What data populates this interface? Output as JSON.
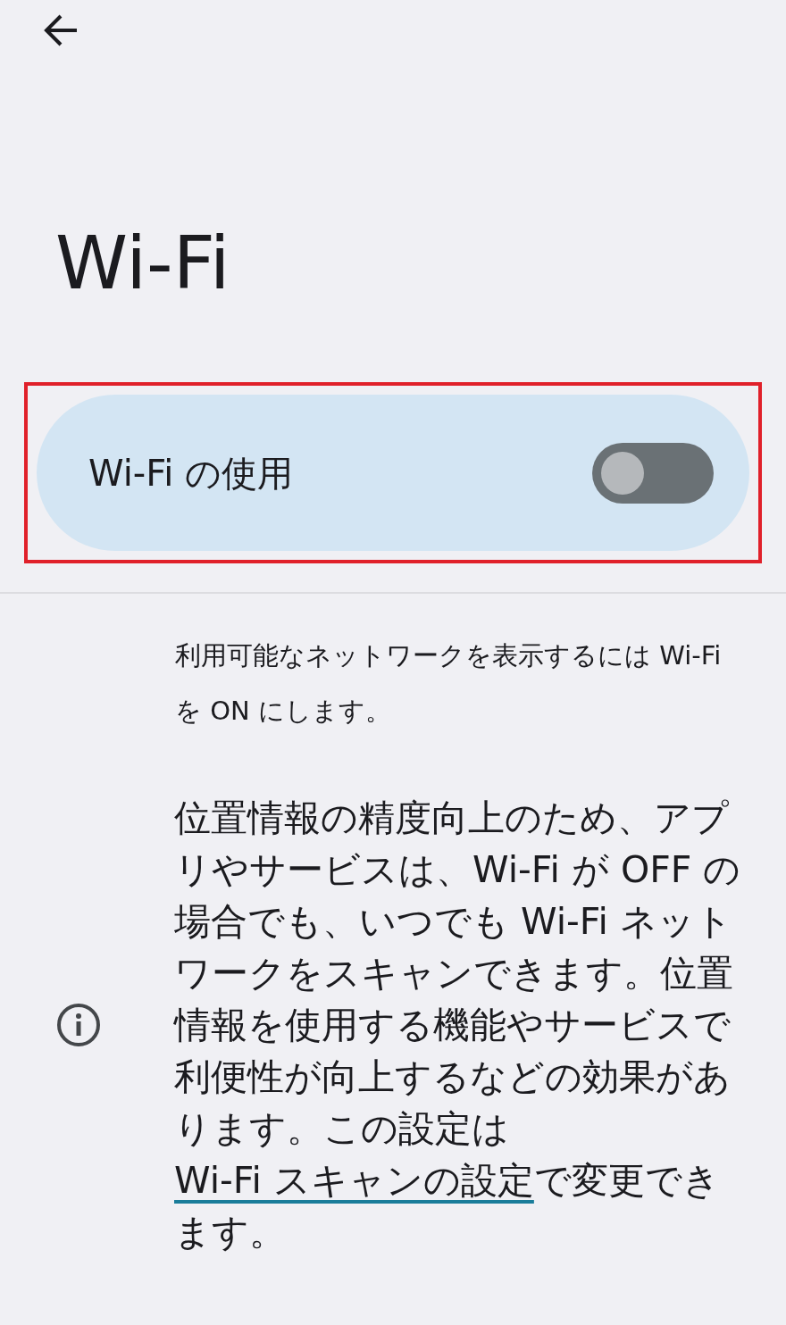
{
  "title": "Wi-Fi",
  "toggle_card": {
    "label": "Wi-Fi の使用",
    "on": false,
    "highlighted": true
  },
  "hint": "利用可能なネットワークを表示するには Wi-Fi を ON にします。",
  "info": {
    "text_before": "位置情報の精度向上のため、アプリやサービスは、Wi-Fi が OFF の場合でも、いつでも Wi-Fi ネットワークをスキャンできます。位置情報を使用する機能やサービスで利便性が向上するなどの効果があります。この設定は ",
    "link": "Wi-Fi スキャンの設定",
    "text_after": "で変更できます。"
  }
}
